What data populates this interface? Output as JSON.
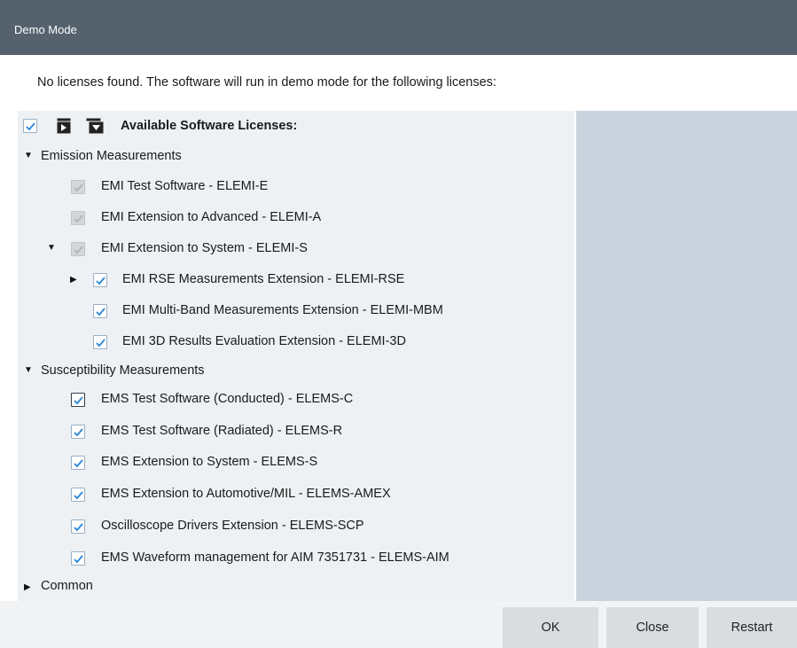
{
  "window": {
    "title": "Demo Mode"
  },
  "message": "No licenses found. The software will run in demo mode for the following licenses:",
  "tree_header": {
    "label": "Available Software Licenses:"
  },
  "categories": [
    {
      "label": "Emission Measurements",
      "expanded": true
    },
    {
      "label": "Susceptibility Measurements",
      "expanded": true
    },
    {
      "label": "Common",
      "expanded": false
    }
  ],
  "emission_items": [
    "EMI Test Software  -  ELEMI-E",
    "EMI Extension to Advanced  -  ELEMI-A",
    "EMI Extension to System  -  ELEMI-S",
    "EMI RSE Measurements Extension  -  ELEMI-RSE",
    "EMI Multi-Band Measurements Extension  -  ELEMI-MBM",
    "EMI 3D Results Evaluation Extension  -  ELEMI-3D"
  ],
  "susceptibility_items": [
    "EMS Test Software (Conducted)  -  ELEMS-C",
    "EMS Test Software (Radiated)  -  ELEMS-R",
    "EMS Extension to System  -  ELEMS-S",
    "EMS Extension to Automotive/MIL  -  ELEMS-AMEX",
    "Oscilloscope Drivers Extension  -  ELEMS-SCP",
    "EMS Waveform management for AIM 7351731  -  ELEMS-AIM"
  ],
  "buttons": {
    "ok": "OK",
    "close": "Close",
    "restart": "Restart"
  },
  "colors": {
    "titlebar": "#55626e",
    "check": "#2a86d6",
    "panel": "#eef1f4",
    "side_panel": "#c9d3dd"
  }
}
